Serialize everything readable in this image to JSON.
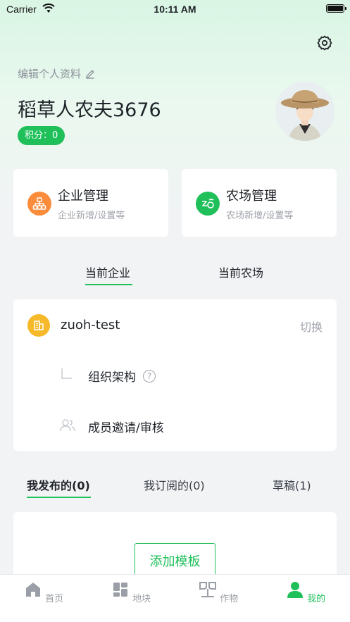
{
  "status_bar": {
    "carrier": "Carrier",
    "time": "10:11 AM"
  },
  "profile": {
    "edit_label": "编辑个人资料",
    "username": "稻草人农夫3676",
    "points_label": "积分：0"
  },
  "management": [
    {
      "title": "企业管理",
      "subtitle": "企业新增/设置等",
      "icon": "org-chart-icon",
      "color": "#fb8c3c"
    },
    {
      "title": "农场管理",
      "subtitle": "农场新增/设置等",
      "icon": "farm-icon",
      "color": "#1fc05a"
    }
  ],
  "current_tabs": [
    {
      "label": "当前企业",
      "active": true
    },
    {
      "label": "当前农场",
      "active": false
    }
  ],
  "company": {
    "name": "zuoh-test",
    "switch_label": "切换",
    "rows": [
      {
        "label": "组织架构",
        "icon": "tree-branch-icon",
        "help": "?"
      },
      {
        "label": "成员邀请/审核",
        "icon": "members-icon"
      }
    ]
  },
  "publish_tabs": [
    {
      "label": "我发布的(0)",
      "active": true
    },
    {
      "label": "我订阅的(0)",
      "active": false
    },
    {
      "label": "草稿(1)",
      "active": false
    }
  ],
  "content": {
    "add_template_label": "添加模板"
  },
  "tabbar": [
    {
      "label": "首页",
      "icon": "home-icon",
      "active": false
    },
    {
      "label": "地块",
      "icon": "land-plot-icon",
      "active": false
    },
    {
      "label": "作物",
      "icon": "crop-icon",
      "active": false
    },
    {
      "label": "我的",
      "icon": "user-icon",
      "active": true
    }
  ],
  "colors": {
    "accent": "#1fc05a",
    "orange": "#fb8c3c",
    "yellow": "#f5b92a"
  }
}
